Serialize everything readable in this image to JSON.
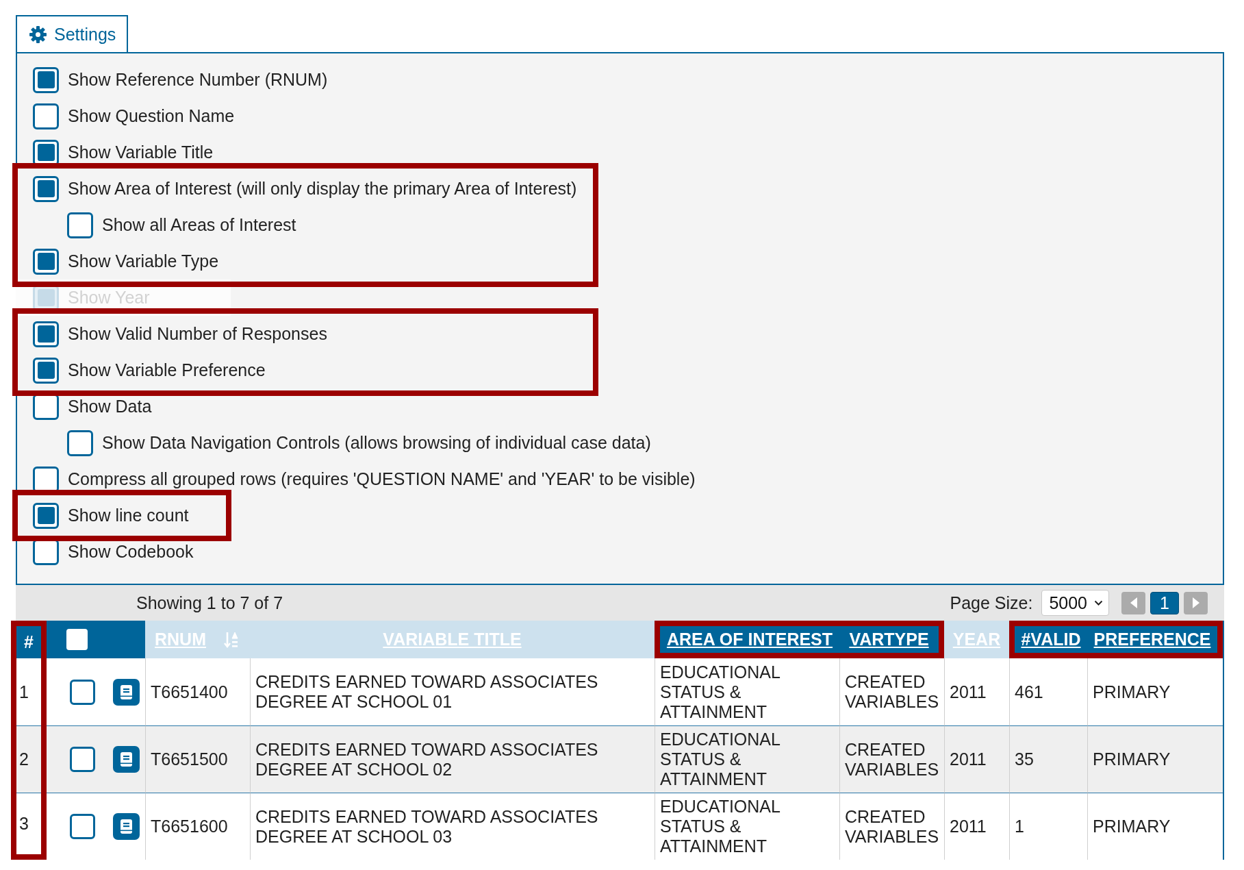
{
  "settings": {
    "tab": {
      "label": "Settings",
      "selected": true
    },
    "groups": [
      {
        "highlighted": false,
        "options": [
          {
            "label": "Show Reference Number (RNUM)",
            "checked": true,
            "disabled": false
          },
          {
            "label": "Show Question Name",
            "checked": false,
            "disabled": false
          },
          {
            "label": "Show Variable Title",
            "checked": true,
            "disabled": false
          }
        ]
      },
      {
        "highlighted": true,
        "options": [
          {
            "label": "Show Area of Interest (will only display the primary Area of Interest)",
            "checked": true,
            "disabled": false,
            "children": [
              {
                "label": "Show all Areas of Interest",
                "checked": false,
                "disabled": false
              }
            ]
          },
          {
            "label": "Show Variable Type",
            "checked": true,
            "disabled": false
          }
        ]
      },
      {
        "highlighted": false,
        "options": [
          {
            "label": "Show Year",
            "checked": true,
            "disabled": true
          }
        ]
      },
      {
        "highlighted": true,
        "options": [
          {
            "label": "Show Valid Number of Responses",
            "checked": true,
            "disabled": false
          },
          {
            "label": "Show Variable Preference",
            "checked": true,
            "disabled": false
          }
        ]
      },
      {
        "highlighted": false,
        "options": [
          {
            "label": "Show Data",
            "checked": false,
            "disabled": false,
            "children": [
              {
                "label": "Show Data Navigation Controls (allows browsing of individual case data)",
                "checked": false,
                "disabled": false
              }
            ]
          },
          {
            "label": "Compress all grouped rows (requires 'QUESTION NAME' and 'YEAR' to be visible)",
            "checked": false,
            "disabled": false
          }
        ]
      },
      {
        "highlighted": true,
        "options": [
          {
            "label": "Show line count",
            "checked": true,
            "disabled": false
          }
        ]
      },
      {
        "highlighted": false,
        "options": [
          {
            "label": "Show Codebook",
            "checked": false,
            "disabled": false
          }
        ]
      }
    ]
  },
  "table": {
    "status": "Showing 1 to 7 of 7",
    "page_size": {
      "label": "Page Size:",
      "value": "5000"
    },
    "pager": {
      "previous": {
        "disabled": true
      },
      "pages": [
        {
          "label": "1",
          "selected": true
        }
      ],
      "next": {
        "disabled": true
      }
    },
    "columns": [
      {
        "kind": "index",
        "label": "#",
        "emphasized": true,
        "highlighted": true
      },
      {
        "kind": "select",
        "checked": false,
        "emphasized": true,
        "highlighted": false
      },
      {
        "kind": "codebook",
        "emphasized": true,
        "highlighted": false
      },
      {
        "kind": "text",
        "label": "RNUM",
        "sorted": true,
        "emphasized": false,
        "highlighted": false
      },
      {
        "kind": "text",
        "label": "VARIABLE TITLE",
        "sorted": false,
        "emphasized": false,
        "highlighted": false
      },
      {
        "kind": "text",
        "label": "AREA OF INTEREST",
        "sorted": false,
        "emphasized": true,
        "highlighted": true
      },
      {
        "kind": "text",
        "label": "VARTYPE",
        "sorted": false,
        "emphasized": true,
        "highlighted": true
      },
      {
        "kind": "text",
        "label": "YEAR",
        "sorted": false,
        "emphasized": false,
        "highlighted": false
      },
      {
        "kind": "text",
        "label": "#VALID",
        "sorted": false,
        "emphasized": true,
        "highlighted": true
      },
      {
        "kind": "text",
        "label": "PREFERENCE",
        "sorted": false,
        "emphasized": true,
        "highlighted": true
      }
    ],
    "rows": [
      {
        "selected": false,
        "cells": [
          "1",
          "",
          "",
          "T6651400",
          "CREDITS EARNED TOWARD ASSOCIATES DEGREE AT SCHOOL 01",
          "EDUCATIONAL STATUS & ATTAINMENT",
          "CREATED VARIABLES",
          "2011",
          "461",
          "PRIMARY"
        ]
      },
      {
        "selected": false,
        "cells": [
          "2",
          "",
          "",
          "T6651500",
          "CREDITS EARNED TOWARD ASSOCIATES DEGREE AT SCHOOL 02",
          "EDUCATIONAL STATUS & ATTAINMENT",
          "CREATED VARIABLES",
          "2011",
          "35",
          "PRIMARY"
        ]
      },
      {
        "selected": false,
        "cells": [
          "3",
          "",
          "",
          "T6651600",
          "CREDITS EARNED TOWARD ASSOCIATES DEGREE AT SCHOOL 03",
          "EDUCATIONAL STATUS & ATTAINMENT",
          "CREATED VARIABLES",
          "2011",
          "1",
          "PRIMARY"
        ]
      }
    ]
  }
}
